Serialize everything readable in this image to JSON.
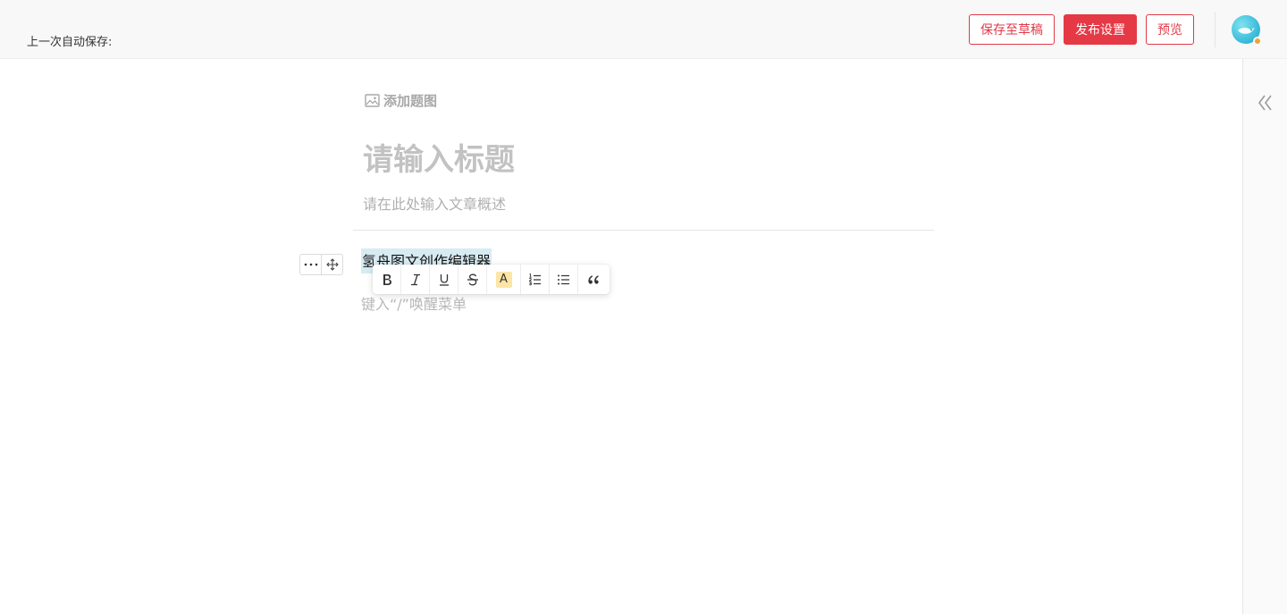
{
  "header": {
    "autosave_text": "上一次自动保存:",
    "save_draft_label": "保存至草稿",
    "publish_settings_label": "发布设置",
    "preview_label": "预览"
  },
  "colors": {
    "accent": "#e63946",
    "selection": "#d7ebf3",
    "highlight": "#fce5a6"
  },
  "editor": {
    "add_cover_label": "添加题图",
    "title_placeholder": "请输入标题",
    "summary_placeholder": "请在此处输入文章概述",
    "selected_text": "氢舟图文创作编辑器",
    "empty_line_hint": "键入“/”唤醒菜单"
  },
  "toolbar_icons": [
    "bold-icon",
    "italic-icon",
    "underline-icon",
    "strikethrough-icon",
    "highlight-icon",
    "ordered-list-icon",
    "bullet-list-icon",
    "quote-icon"
  ],
  "toolbar": {
    "highlight_letter": "A"
  }
}
